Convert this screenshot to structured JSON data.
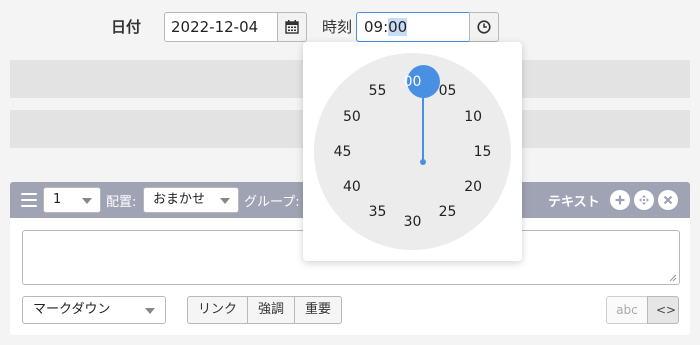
{
  "date": {
    "label": "日付",
    "value": "2022-12-04",
    "button_icon": "calendar-icon"
  },
  "time": {
    "label": "時刻",
    "value_prefix": "09:",
    "value_selected": "00",
    "button_icon": "clock-icon"
  },
  "clock": {
    "selected": "00",
    "minutes": [
      "00",
      "05",
      "10",
      "15",
      "20",
      "25",
      "30",
      "35",
      "40",
      "45",
      "50",
      "55"
    ]
  },
  "toolbar": {
    "menu_icon": "hamburger-icon",
    "number_select": "1",
    "placement_label": "配置:",
    "placement_select": "おまかせ",
    "group_label": "グループ:",
    "text_label": "テキスト",
    "add_icon": "plus-icon",
    "move_icon": "move-icon",
    "close_icon": "close-icon"
  },
  "editor": {
    "format_select": "マークダウン",
    "buttons": [
      "リンク",
      "強調",
      "重要"
    ],
    "mode_plain": "abc",
    "mode_code": "<>"
  },
  "colors": {
    "accent": "#4a90e2",
    "toolbar": "#a0a3b4"
  }
}
